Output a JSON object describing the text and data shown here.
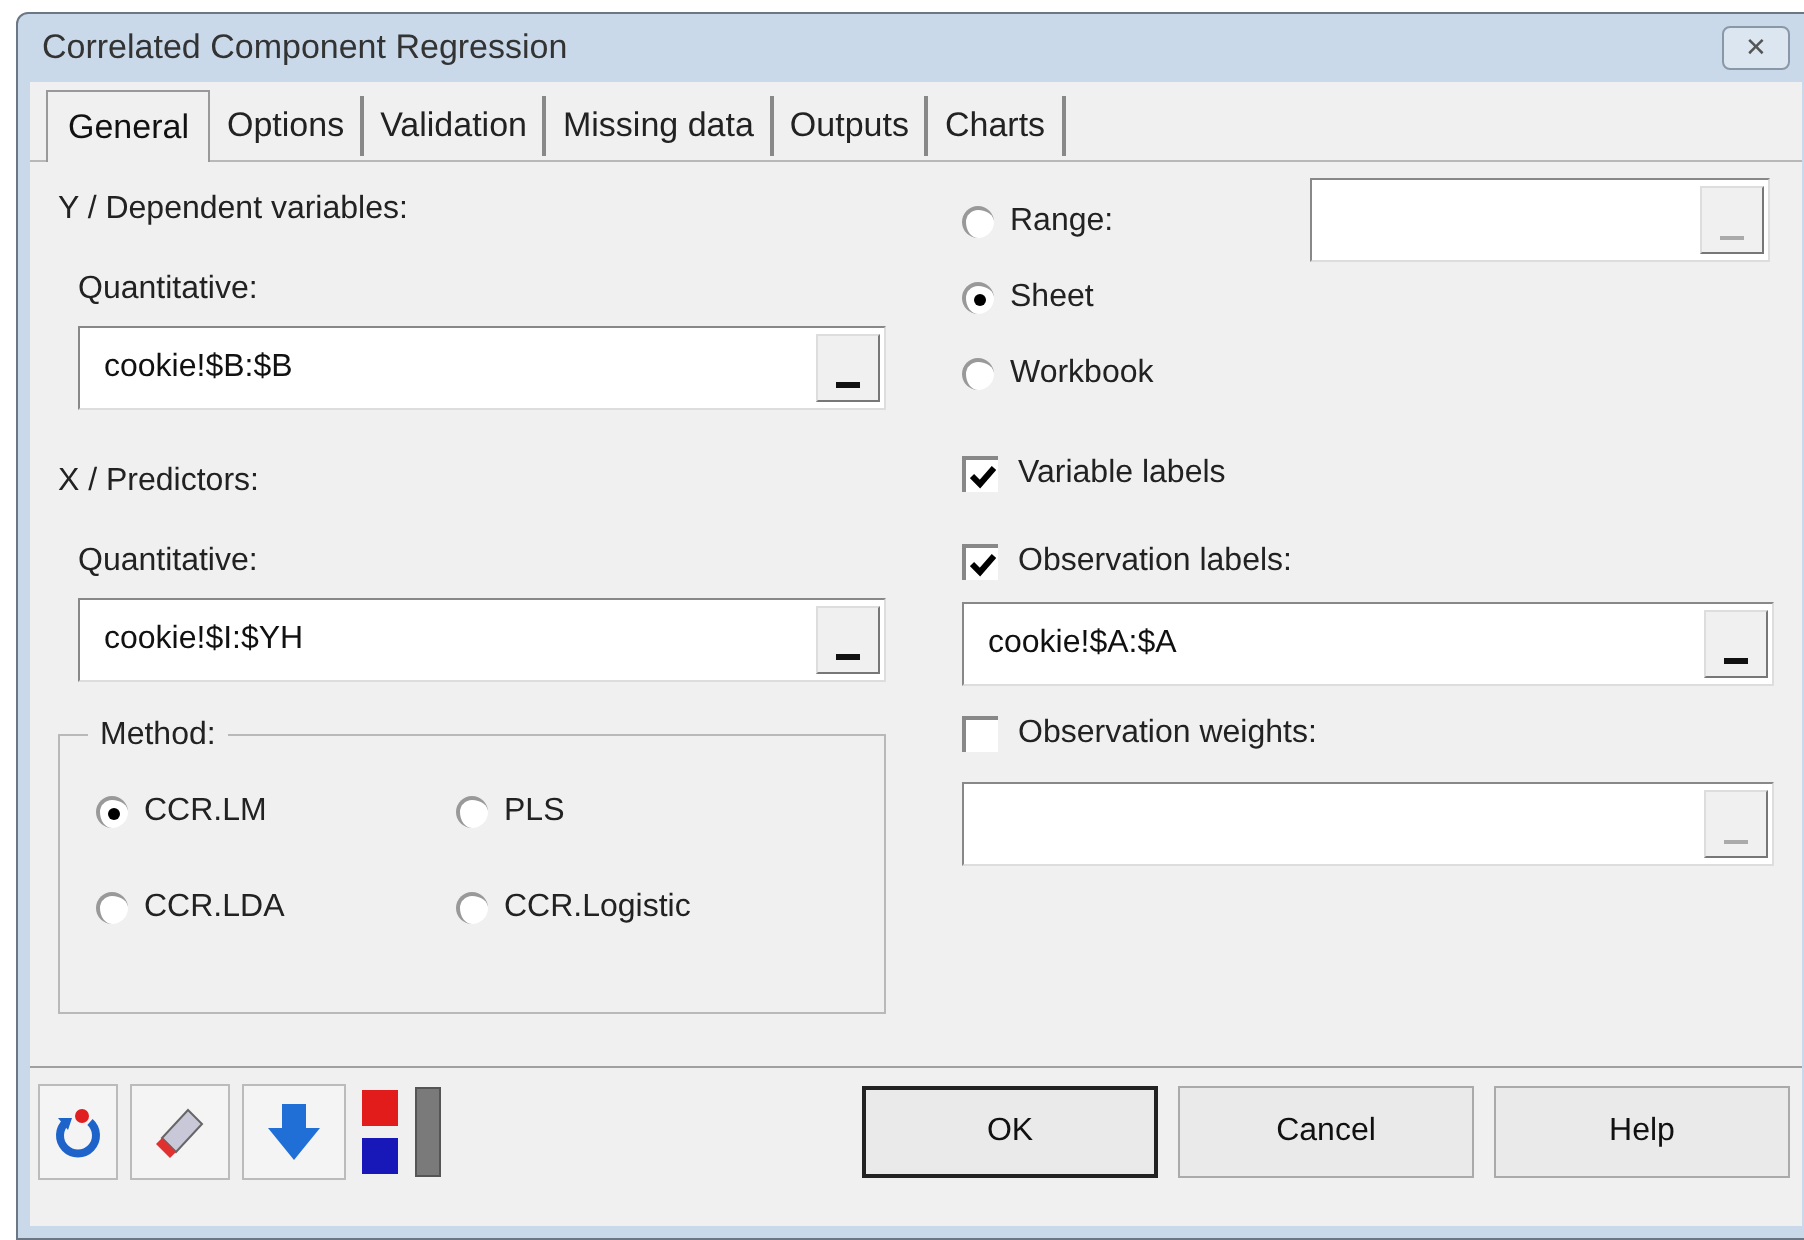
{
  "window": {
    "title": "Correlated Component Regression",
    "close_label": "✕"
  },
  "tabs": [
    {
      "label": "General",
      "selected": true
    },
    {
      "label": "Options",
      "selected": false
    },
    {
      "label": "Validation",
      "selected": false
    },
    {
      "label": "Missing data",
      "selected": false
    },
    {
      "label": "Outputs",
      "selected": false
    },
    {
      "label": "Charts",
      "selected": false
    }
  ],
  "dependent": {
    "heading": "Y / Dependent variables:",
    "label": "Quantitative:",
    "field": {
      "value": "cookie!$B:$B",
      "disabled": false
    }
  },
  "predictors": {
    "heading": "X / Predictors:",
    "label": "Quantitative:",
    "field": {
      "value": "cookie!$I:$YH",
      "disabled": false
    }
  },
  "method": {
    "title": "Method:",
    "options": [
      {
        "label": "CCR.LM",
        "selected": true
      },
      {
        "label": "PLS",
        "selected": false
      },
      {
        "label": "CCR.LDA",
        "selected": false
      },
      {
        "label": "CCR.Logistic",
        "selected": false
      }
    ]
  },
  "range_options": [
    {
      "label": "Range:",
      "selected": false
    },
    {
      "label": "Sheet",
      "selected": true
    },
    {
      "label": "Workbook",
      "selected": false
    }
  ],
  "range_field": {
    "disabled": true
  },
  "variable_labels": {
    "label": "Variable labels",
    "checked": true
  },
  "observation_labels": {
    "label": "Observation labels:",
    "checked": true,
    "field": {
      "value": "cookie!$A:$A",
      "disabled": false
    }
  },
  "observation_weights": {
    "label": "Observation weights:",
    "checked": false,
    "field": {
      "disabled": true
    }
  },
  "buttons": [
    {
      "label": "OK",
      "default": true
    },
    {
      "label": "Cancel",
      "default": false
    },
    {
      "label": "Help",
      "default": false
    }
  ]
}
